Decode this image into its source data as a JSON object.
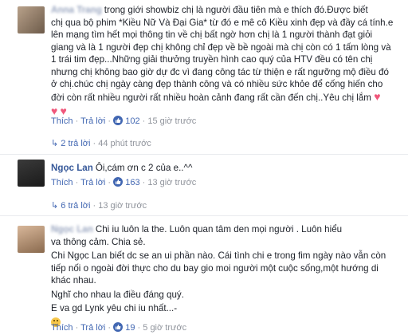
{
  "comments": [
    {
      "author": "Anna Trang",
      "text_lines": [
        "trong giới showbiz chị là người đầu tiên mà e thích đó.Được biết",
        "chị qua bộ phim *Kiều Nữ Và Đại Gia* từ đó e mê cô Kiều xinh đẹp và đầy cá tính.e",
        "lên mạng tìm hết mọi thông tin về chị bất ngờ hơn chị là 1 người thành đạt giỏi",
        "giang và là 1 người đẹp chị không chỉ đẹp về bề ngoài mà chị còn có 1 tấm lòng và",
        "1 trái tim đẹp...Những giải thưởng truyền hình cao quý của HTV đều có tên chị",
        "nhưng chị không bao giờ dự đc vì đang công tác từ thiện e rất ngưỡng mộ điều đó",
        "ở chị.chúc chị ngày càng đẹp thành công và có nhiều sức khỏe để cống hiến cho",
        "đời còn rất nhiều người rất nhiều hoàn cảnh đang rất cần đến chị..Yêu chị lắm"
      ],
      "like": "Thích",
      "reply": "Trả lời",
      "likes": "102",
      "time": "15 giờ trước"
    },
    {
      "author": "Ngọc Lan",
      "text": "Ôi,cám ơn c 2 của e..^^",
      "like": "Thích",
      "reply": "Trả lời",
      "likes": "163",
      "time": "13 giờ trước"
    },
    {
      "author": "Ngọc Lan",
      "text_lines": [
        "Chi iu luôn la the. Luôn quan tâm den mọi người . Luôn hiểu",
        "va thông cảm. Chia sẻ."
      ],
      "para2_lines": [
        "Chi Ngọc Lan biết dc se an ui phần nào. Cái tình chi e trong fim ngày nào vẫn còn",
        "tiếp nối o ngoài đời thực cho du bay gio moi người một cuộc sống,một hướng di",
        "khác nhau."
      ],
      "para3": "Nghĩ cho nhau la điều đáng quý.",
      "para4": "E va gd Lynk yêu chi iu nhất...-",
      "like": "Thích",
      "reply": "Trả lời",
      "likes": "19",
      "time": "5 giờ trước"
    }
  ],
  "reply_rows": [
    {
      "label": "2 trả lời",
      "time": "44 phút trước"
    },
    {
      "label": "6 trả lời",
      "time": "13 giờ trước"
    }
  ],
  "meta_sep": "·"
}
